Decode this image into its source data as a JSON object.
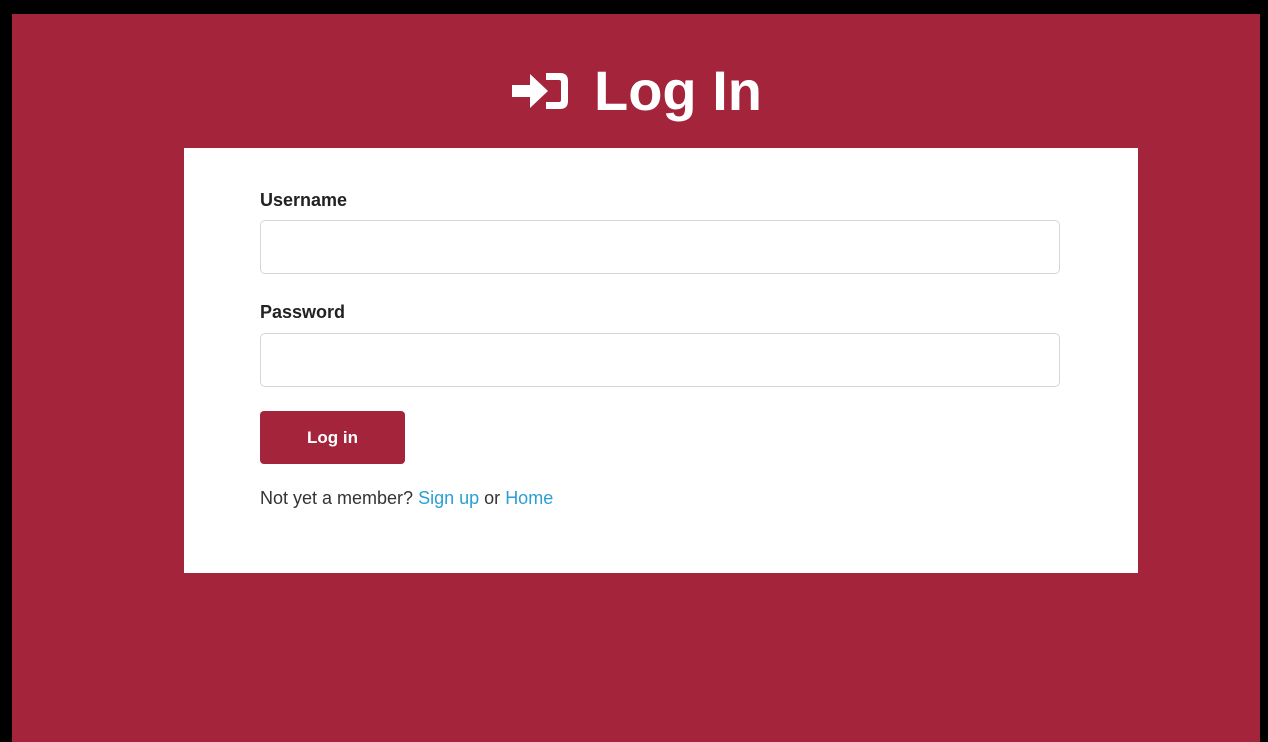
{
  "page": {
    "title": "Log In",
    "title_icon": "sign-in-icon",
    "background_color": "#a3243b",
    "card_color": "#ffffff"
  },
  "form": {
    "username_label": "Username",
    "username_value": "",
    "password_label": "Password",
    "password_value": "",
    "submit_label": "Log in",
    "submit_color": "#a3243b"
  },
  "footer": {
    "prompt_text": "Not yet a member?",
    "signup_link": "Sign up",
    "connector": "or",
    "home_link": "Home",
    "link_color": "#2a9fd6"
  }
}
